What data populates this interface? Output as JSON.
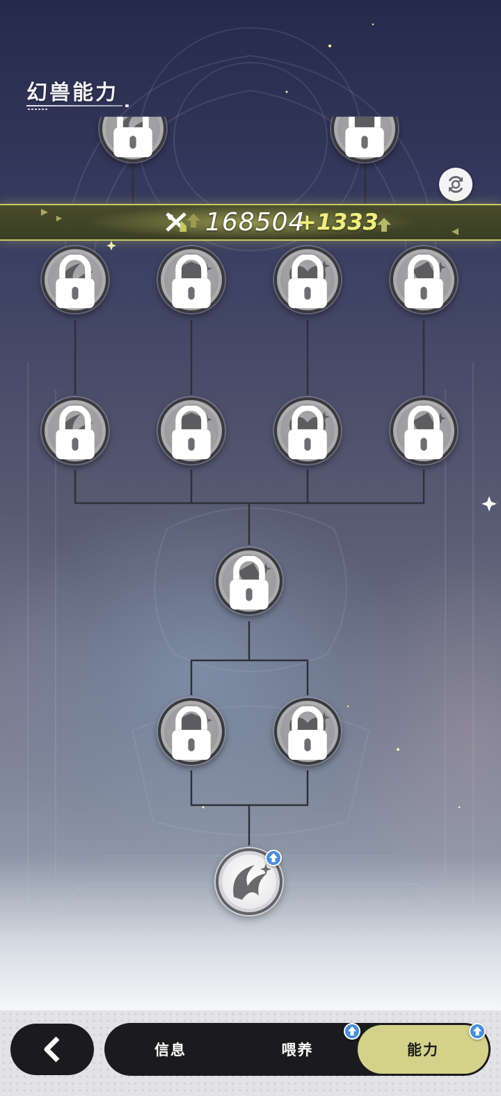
{
  "page": {
    "title": "幻兽能力"
  },
  "power": {
    "value": "168504",
    "delta": "+1333"
  },
  "icons": {
    "refresh": "refresh-icon",
    "power": "combat-power-icon",
    "back": "chevron-left-icon",
    "lock": "lock-icon",
    "upgrade": "upgrade-arrow-icon"
  },
  "tabs": {
    "info": "信息",
    "feed": "喂养",
    "ability": "能力"
  },
  "colors": {
    "accent": "#d4d28a",
    "power_delta": "#f1ef7c",
    "badge": "#4a8ed6",
    "node_locked": "#9e9ea0",
    "node_active": "#ececee"
  },
  "skill_tree": {
    "nodes": [
      {
        "id": "root",
        "emblem": "claw",
        "state": "unlocked",
        "has_upgrade": true
      },
      {
        "id": "r2-left",
        "emblem": "shield",
        "state": "locked"
      },
      {
        "id": "r2-right",
        "emblem": "heart",
        "state": "locked"
      },
      {
        "id": "r3-center",
        "emblem": "card",
        "state": "locked"
      },
      {
        "id": "r4-1",
        "emblem": "claw",
        "state": "locked"
      },
      {
        "id": "r4-2",
        "emblem": "shield",
        "state": "locked"
      },
      {
        "id": "r4-3",
        "emblem": "heart",
        "state": "locked"
      },
      {
        "id": "r4-4",
        "emblem": "card",
        "state": "locked"
      },
      {
        "id": "r5-1",
        "emblem": "claw",
        "state": "locked"
      },
      {
        "id": "r5-2",
        "emblem": "shield",
        "state": "locked"
      },
      {
        "id": "r5-3",
        "emblem": "heart",
        "state": "locked"
      },
      {
        "id": "r5-4",
        "emblem": "card",
        "state": "locked"
      },
      {
        "id": "r6-left",
        "emblem": "claw",
        "state": "locked"
      },
      {
        "id": "r6-right",
        "emblem": "shield",
        "state": "locked"
      }
    ]
  }
}
